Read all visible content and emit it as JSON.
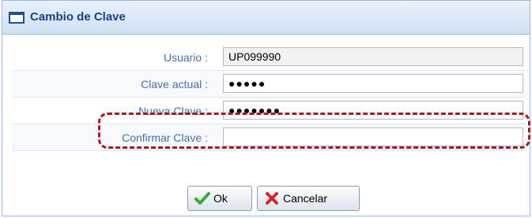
{
  "window": {
    "title": "Cambio de Clave",
    "icon": "window-icon"
  },
  "form": {
    "usuario": {
      "label": "Usuario :",
      "value": "UP099990"
    },
    "clave_actual": {
      "label": "Clave actual :",
      "value": "●●●●●"
    },
    "nueva_clave": {
      "label": "Nueva Clave :",
      "value": "●●●●●●●"
    },
    "confirmar_clave": {
      "label": "Confirmar Clave :",
      "value": ""
    }
  },
  "buttons": {
    "ok_label": "Ok",
    "ok_icon": "checkmark-icon",
    "cancel_label": "Cancelar",
    "cancel_icon": "x-icon"
  },
  "colors": {
    "title_text": "#15428b",
    "label_text": "#4a6ea9",
    "highlight": "#a51a23"
  }
}
